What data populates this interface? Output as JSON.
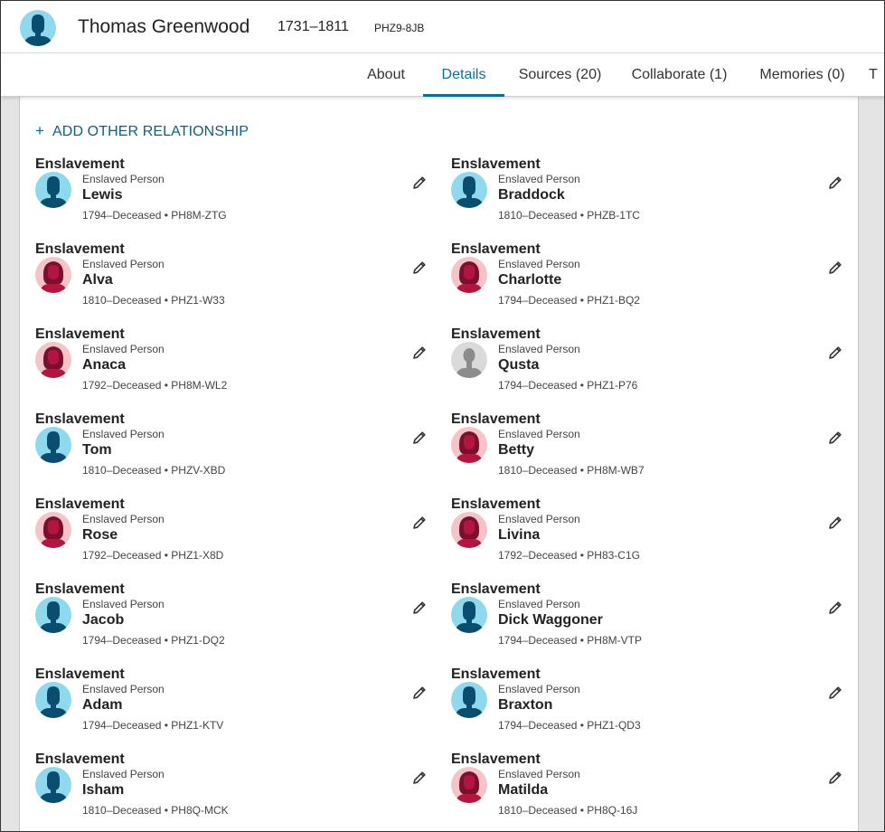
{
  "person": {
    "name": "Thomas Greenwood",
    "lifespan": "1731–1811",
    "pid": "PHZ9-8JB"
  },
  "tabs": [
    {
      "label": "About",
      "active": false
    },
    {
      "label": "Details",
      "active": true
    },
    {
      "label": "Sources (20)",
      "active": false
    },
    {
      "label": "Collaborate (1)",
      "active": false
    },
    {
      "label": "Memories (0)",
      "active": false
    },
    {
      "label": "T",
      "active": false
    }
  ],
  "add_relationship": {
    "plus": "+",
    "label": "ADD OTHER RELATIONSHIP"
  },
  "relationships": [
    {
      "type": "Enslavement",
      "role": "Enslaved Person",
      "name": "Lewis",
      "meta": "1794–Deceased • PH8M-ZTG",
      "gender": "male"
    },
    {
      "type": "Enslavement",
      "role": "Enslaved Person",
      "name": "Braddock",
      "meta": "1810–Deceased • PHZB-1TC",
      "gender": "male"
    },
    {
      "type": "Enslavement",
      "role": "Enslaved Person",
      "name": "Alva",
      "meta": "1810–Deceased • PHZ1-W33",
      "gender": "female"
    },
    {
      "type": "Enslavement",
      "role": "Enslaved Person",
      "name": "Charlotte",
      "meta": "1794–Deceased • PHZ1-BQ2",
      "gender": "female"
    },
    {
      "type": "Enslavement",
      "role": "Enslaved Person",
      "name": "Anaca",
      "meta": "1792–Deceased • PH8M-WL2",
      "gender": "female"
    },
    {
      "type": "Enslavement",
      "role": "Enslaved Person",
      "name": "Qusta",
      "meta": "1794–Deceased • PHZ1-P76",
      "gender": "unknown"
    },
    {
      "type": "Enslavement",
      "role": "Enslaved Person",
      "name": "Tom",
      "meta": "1810–Deceased • PHZV-XBD",
      "gender": "male"
    },
    {
      "type": "Enslavement",
      "role": "Enslaved Person",
      "name": "Betty",
      "meta": "1810–Deceased • PH8M-WB7",
      "gender": "female"
    },
    {
      "type": "Enslavement",
      "role": "Enslaved Person",
      "name": "Rose",
      "meta": "1792–Deceased • PHZ1-X8D",
      "gender": "female"
    },
    {
      "type": "Enslavement",
      "role": "Enslaved Person",
      "name": "Livina",
      "meta": "1792–Deceased • PH83-C1G",
      "gender": "female"
    },
    {
      "type": "Enslavement",
      "role": "Enslaved Person",
      "name": "Jacob",
      "meta": "1794–Deceased • PHZ1-DQ2",
      "gender": "male"
    },
    {
      "type": "Enslavement",
      "role": "Enslaved Person",
      "name": "Dick Waggoner",
      "meta": "1794–Deceased • PH8M-VTP",
      "gender": "male"
    },
    {
      "type": "Enslavement",
      "role": "Enslaved Person",
      "name": "Adam",
      "meta": "1794–Deceased • PHZ1-KTV",
      "gender": "male"
    },
    {
      "type": "Enslavement",
      "role": "Enslaved Person",
      "name": "Braxton",
      "meta": "1794–Deceased • PHZ1-QD3",
      "gender": "male"
    },
    {
      "type": "Enslavement",
      "role": "Enslaved Person",
      "name": "Isham",
      "meta": "1810–Deceased • PH8Q-MCK",
      "gender": "male"
    },
    {
      "type": "Enslavement",
      "role": "Enslaved Person",
      "name": "Matilda",
      "meta": "1810–Deceased • PH8Q-16J",
      "gender": "female"
    }
  ],
  "icons": {
    "edit": "pencil-icon",
    "male_avatar": "male-avatar-icon",
    "female_avatar": "female-avatar-icon",
    "unknown_avatar": "unknown-avatar-icon"
  },
  "colors": {
    "accent": "#0f6f93",
    "link": "#0f5f84",
    "male_bg": "#8fd9ef",
    "male_fg": "#0b4d6e",
    "female_bg": "#f6c4c8",
    "female_fg": "#b2163f",
    "unknown_bg": "#dadada",
    "unknown_fg": "#8c8c8c"
  }
}
